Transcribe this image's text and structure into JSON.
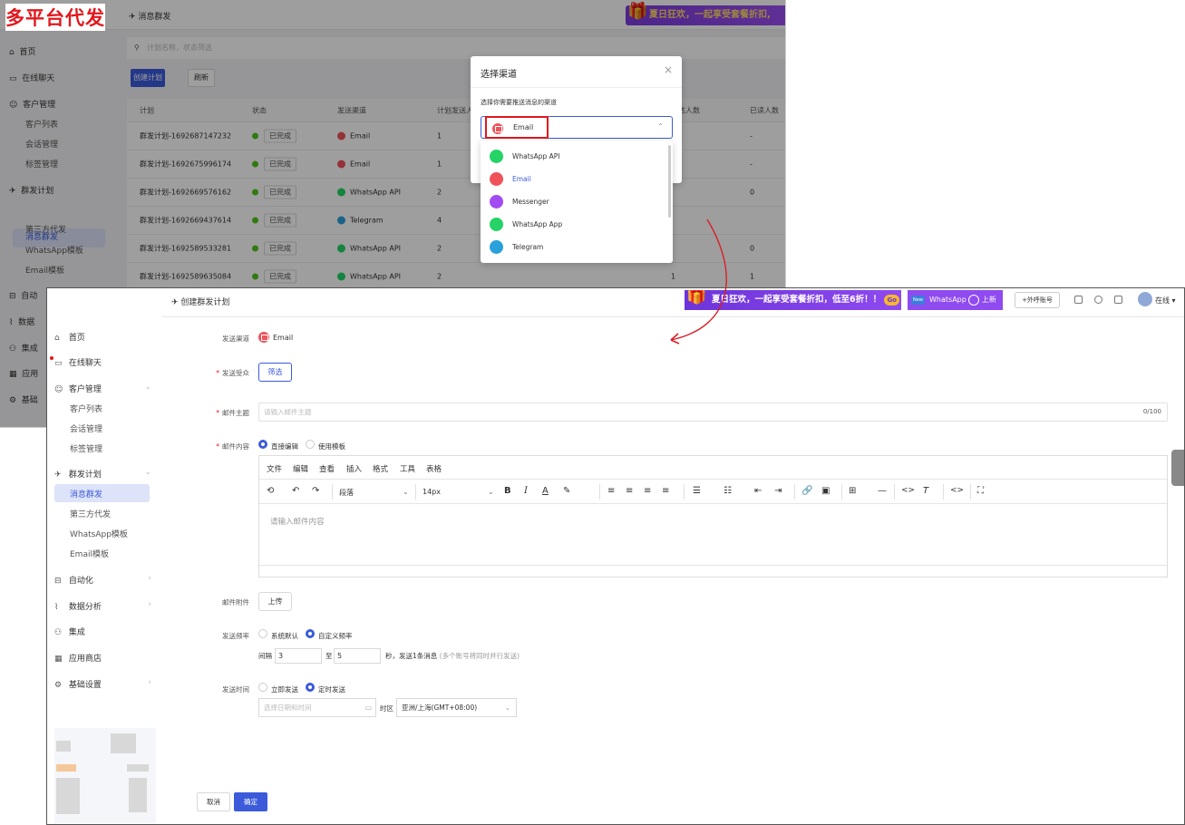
{
  "promo_title": "多平台代发",
  "back": {
    "crumb": "消息群发",
    "banner": "夏日狂欢，一起享受套餐折扣,",
    "sidebar": {
      "home": "首页",
      "chat": "在线聊天",
      "customer": "客户管理",
      "customer_list": "客户列表",
      "session": "会话管理",
      "tags": "标签管理",
      "broadcast": "群发计划",
      "msg_broadcast": "消息群发",
      "third_party": "第三方代发",
      "wa_template": "WhatsApp模板",
      "email_template": "Email模板",
      "auto": "自动",
      "data": "数据",
      "integ": "集成",
      "appstore": "应用",
      "base": "基础"
    },
    "search_placeholder": "计划名称，状态筛选",
    "create_btn": "创建计划",
    "refresh_btn": "刷新",
    "columns": [
      "计划",
      "状态",
      "发送渠道",
      "计划发送人",
      "送达人数",
      "已读人数"
    ],
    "rows": [
      {
        "plan": "群发计划-1692687147232",
        "status": "已完成",
        "channel": "Email",
        "count": "1",
        "delivered": "",
        "read": "-"
      },
      {
        "plan": "群发计划-1692675996174",
        "status": "已完成",
        "channel": "Email",
        "count": "1",
        "delivered": "",
        "read": "-"
      },
      {
        "plan": "群发计划-1692669576162",
        "status": "已完成",
        "channel": "WhatsApp API",
        "count": "2",
        "delivered": "",
        "read": "0"
      },
      {
        "plan": "群发计划-1692669437614",
        "status": "已完成",
        "channel": "Telegram",
        "count": "4",
        "delivered": "",
        "read": ""
      },
      {
        "plan": "群发计划-1692589533281",
        "status": "已完成",
        "channel": "WhatsApp API",
        "count": "2",
        "delivered": "",
        "read": "0"
      },
      {
        "plan": "群发计划-1692589635084",
        "status": "已完成",
        "channel": "WhatsApp API",
        "count": "2",
        "delivered": "1",
        "read": "1"
      }
    ],
    "modal": {
      "title": "选择渠道",
      "close": "×",
      "hint": "选择你需要推送消息的渠道",
      "selected": "Email",
      "options": [
        {
          "label": "WhatsApp API",
          "color": "#25d366"
        },
        {
          "label": "Email",
          "color": "#f0525a"
        },
        {
          "label": "Messenger",
          "color": "#a24bf2"
        },
        {
          "label": "WhatsApp App",
          "color": "#25d366"
        },
        {
          "label": "Telegram",
          "color": "#2aa1da"
        }
      ]
    }
  },
  "front": {
    "crumb": "创建群发计划",
    "banner": "夏日狂欢，一起享受套餐折扣，低至6折！！",
    "banner_badge": "Go",
    "banner2_new": "New",
    "banner2_text": "WhatsApp",
    "banner2_suffix": "上新",
    "outbound_btn": "+外呼账号",
    "status": "在线",
    "sidebar": {
      "home": "首页",
      "chat": "在线聊天",
      "customer": "客户管理",
      "customer_list": "客户列表",
      "session": "会话管理",
      "tags": "标签管理",
      "broadcast": "群发计划",
      "msg_broadcast": "消息群发",
      "third_party": "第三方代发",
      "wa_template": "WhatsApp模板",
      "email_template": "Email模板",
      "automation": "自动化",
      "analytics": "数据分析",
      "integration": "集成",
      "appstore": "应用商店",
      "settings": "基础设置"
    },
    "form": {
      "channel_label": "发送渠道",
      "channel_value": "Email",
      "audience_label": "发送受众",
      "audience_btn": "筛选",
      "subject_label": "邮件主题",
      "subject_placeholder": "请输入邮件主题",
      "subject_count": "0/100",
      "content_label": "邮件内容",
      "content_opt1": "直接编辑",
      "content_opt2": "使用模板",
      "menus": [
        "文件",
        "编辑",
        "查看",
        "插入",
        "格式",
        "工具",
        "表格"
      ],
      "paragraph": "段落",
      "font_size": "14px",
      "editor_placeholder": "请输入邮件内容",
      "attach_label": "邮件附件",
      "upload_btn": "上传",
      "freq_label": "发送频率",
      "freq_opt1": "系统默认",
      "freq_opt2": "自定义频率",
      "interval_prefix": "间隔",
      "interval_from": "3",
      "interval_to_label": "至",
      "interval_to": "5",
      "interval_suffix": "秒，发送1条消息",
      "interval_hint": "(多个账号将同时并行发送)",
      "time_label": "发送时间",
      "time_opt1": "立即发送",
      "time_opt2": "定时发送",
      "date_placeholder": "选择日期和时间",
      "tz_label": "时区",
      "tz_value": "亚洲/上海(GMT+08:00)",
      "cancel": "取消",
      "confirm": "确定"
    }
  }
}
